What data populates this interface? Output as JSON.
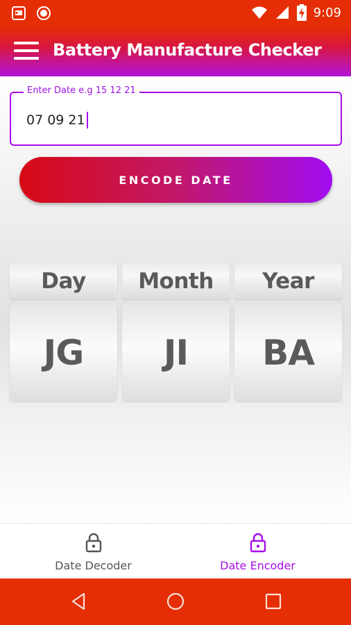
{
  "status_bar": {
    "time": "9:09",
    "left_icons": [
      "notification-app-icon",
      "record-icon"
    ],
    "right_icons": [
      "wifi-icon",
      "signal-icon",
      "battery-charging-icon"
    ]
  },
  "app_bar": {
    "title": "Battery Manufacture Checker",
    "menu_icon": "menu-icon"
  },
  "date_input": {
    "label": "Enter Date e.g 15 12 21",
    "value": "07 09 21"
  },
  "encode_button": {
    "label": "ENCODE DATE"
  },
  "results": [
    {
      "header": "Day",
      "code": "JG"
    },
    {
      "header": "Month",
      "code": "JI"
    },
    {
      "header": "Year",
      "code": "BA"
    }
  ],
  "bottom_nav": {
    "items": [
      {
        "label": "Date Decoder",
        "icon": "lock-icon",
        "active": false
      },
      {
        "label": "Date Encoder",
        "icon": "lock-icon",
        "active": true
      }
    ]
  },
  "colors": {
    "status_bar": "#e52e05",
    "accent_purple": "#a60ee6",
    "button_start": "#d70a14",
    "button_end": "#a10df2",
    "card_text": "#5a5a5a"
  }
}
